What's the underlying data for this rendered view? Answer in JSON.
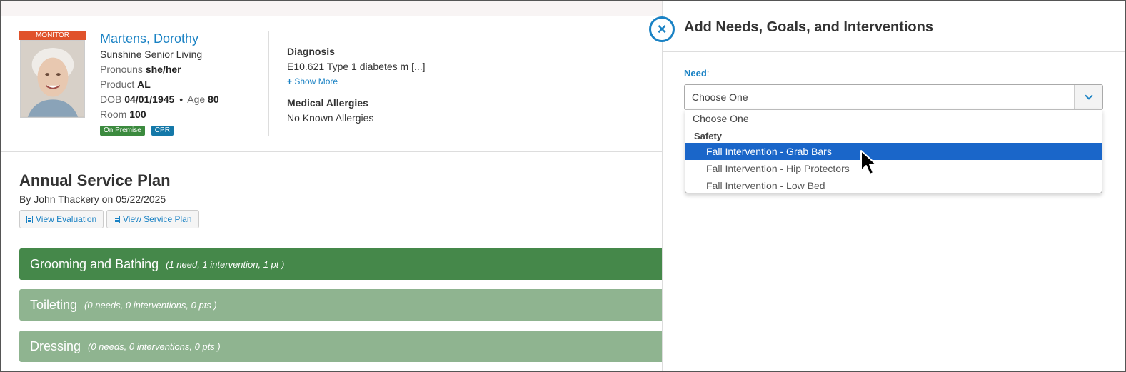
{
  "resident": {
    "badge": "MONITOR",
    "name": "Martens, Dorothy",
    "community": "Sunshine Senior Living",
    "pronouns_label": "Pronouns",
    "pronouns": "she/her",
    "product_label": "Product",
    "product": "AL",
    "dob_label": "DOB",
    "dob": "04/01/1945",
    "separator": "•",
    "age_label": "Age",
    "age": "80",
    "room_label": "Room",
    "room": "100",
    "tags": [
      "On Premise",
      "CPR"
    ]
  },
  "clinical": {
    "diagnosis_label": "Diagnosis",
    "diagnosis": "E10.621 Type 1 diabetes m [...]",
    "show_more": "Show More",
    "allergies_label": "Medical Allergies",
    "allergies": "No Known Allergies"
  },
  "plan": {
    "title": "Annual Service Plan",
    "byline": "By John Thackery on 05/22/2025",
    "view_evaluation": "View Evaluation",
    "view_service_plan": "View Service Plan",
    "categories": [
      {
        "name": "Grooming and Bathing",
        "meta": "(1 need, 1 intervention, 1 pt )"
      },
      {
        "name": "Toileting",
        "meta": "(0 needs, 0 interventions, 0 pts )"
      },
      {
        "name": "Dressing",
        "meta": "(0 needs, 0 interventions, 0 pts )"
      }
    ]
  },
  "panel": {
    "close_icon": "×",
    "title": "Add Needs, Goals, and Interventions",
    "need_label": "Need",
    "need_colon": ":",
    "select_value": "Choose One",
    "options": {
      "placeholder": "Choose One",
      "group": "Safety",
      "items": [
        "Fall Intervention - Grab Bars",
        "Fall Intervention - Hip Protectors",
        "Fall Intervention - Low Bed"
      ],
      "highlighted_index": 0
    }
  },
  "colors": {
    "accent": "#1a82c4",
    "category_active": "#45884a",
    "category_muted": "#8fb490",
    "monitor_badge": "#e0522b",
    "highlight": "#1a66c9"
  }
}
